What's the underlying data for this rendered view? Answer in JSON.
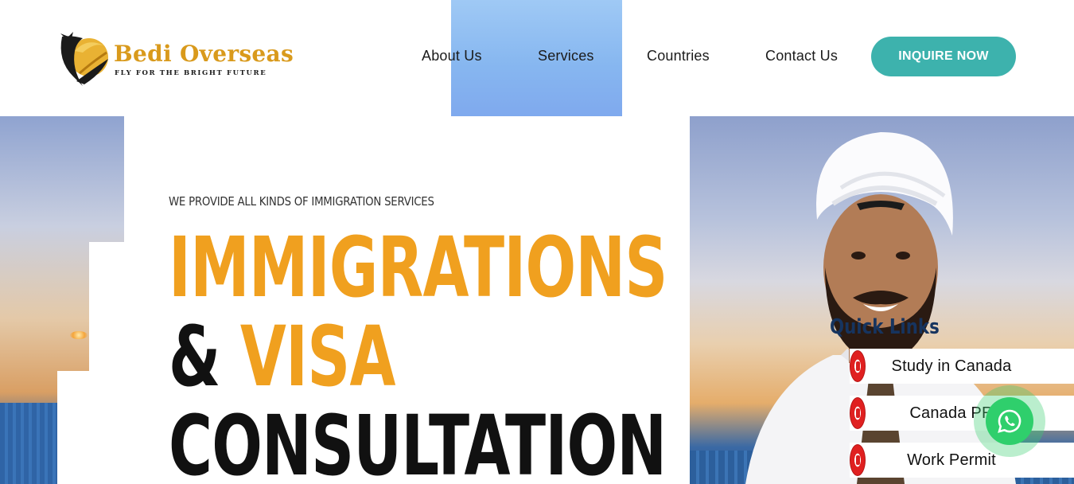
{
  "brand": {
    "name": "Bedi Overseas",
    "tagline": "FLY FOR THE BRIGHT FUTURE",
    "brand_color": "#d99a1c"
  },
  "nav": {
    "items": [
      {
        "label": "About Us"
      },
      {
        "label": "Services"
      },
      {
        "label": "Countries"
      },
      {
        "label": "Contact Us"
      }
    ],
    "cta_label": "INQUIRE NOW",
    "cta_color": "#3db2ad"
  },
  "hero": {
    "subtitle": "WE PROVIDE ALL KINDS OF IMMIGRATION SERVICES",
    "line1": "IMMIGRATIONS",
    "line2_prefix": "& ",
    "line2_accent": "VISA",
    "line3": "CONSULTATION",
    "accent_color": "#f0a01f",
    "text_color": "#111111"
  },
  "quick_links": {
    "title": "Quick Links",
    "items": [
      {
        "label": "Study in Canada",
        "icon": "canada-flag-icon"
      },
      {
        "label": "Canada PR",
        "icon": "canada-flag-icon"
      },
      {
        "label": "Work Permit",
        "icon": "canada-flag-icon"
      }
    ]
  },
  "whatsapp": {
    "icon": "whatsapp-icon",
    "color": "#2fcf6c"
  }
}
